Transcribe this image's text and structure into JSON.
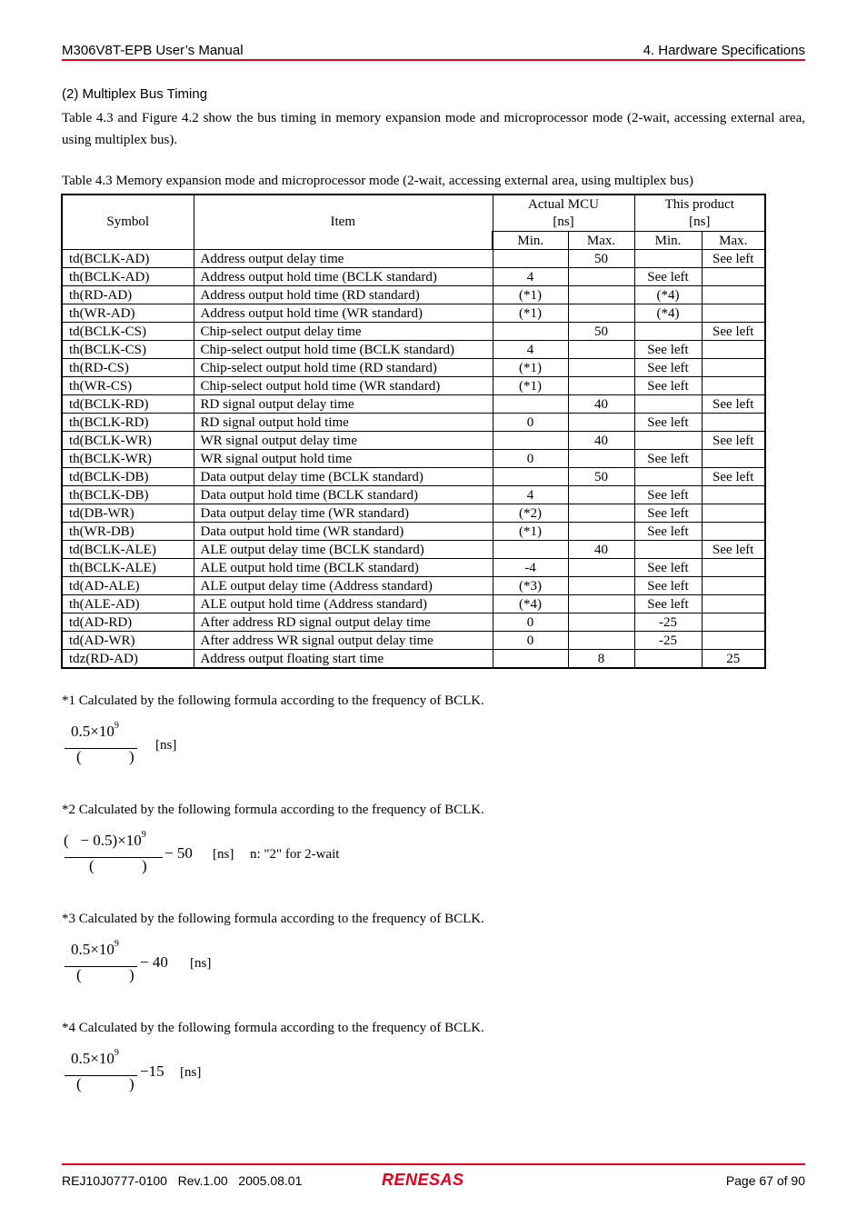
{
  "header": {
    "left": "M306V8T-EPB User’s Manual",
    "right": "4. Hardware Specifications"
  },
  "section": {
    "title": "(2) Multiplex Bus Timing",
    "intro": "Table 4.3 and Figure 4.2 show the bus timing in memory expansion mode and microprocessor mode (2-wait, accessing external area, using multiplex bus)."
  },
  "table": {
    "caption": "Table 4.3 Memory expansion mode and microprocessor mode (2-wait, accessing external area, using multiplex bus)",
    "headers": {
      "symbol": "Symbol",
      "item": "Item",
      "actual_mcu": "Actual MCU",
      "actual_mcu_unit": "[ns]",
      "this_product": "This product",
      "this_product_unit": "[ns]",
      "min": "Min.",
      "max": "Max."
    },
    "rows": [
      {
        "symbol": "td(BCLK-AD)",
        "item": "Address output delay time",
        "mcu_min": "",
        "mcu_max": "50",
        "prod_min": "",
        "prod_max": "See left"
      },
      {
        "symbol": "th(BCLK-AD)",
        "item": "Address output hold time (BCLK standard)",
        "mcu_min": "4",
        "mcu_max": "",
        "prod_min": "See left",
        "prod_max": ""
      },
      {
        "symbol": "th(RD-AD)",
        "item": "Address output hold time (RD standard)",
        "mcu_min": "(*1)",
        "mcu_max": "",
        "prod_min": "(*4)",
        "prod_max": ""
      },
      {
        "symbol": "th(WR-AD)",
        "item": "Address output hold time (WR standard)",
        "mcu_min": "(*1)",
        "mcu_max": "",
        "prod_min": "(*4)",
        "prod_max": ""
      },
      {
        "symbol": "td(BCLK-CS)",
        "item": "Chip-select output delay time",
        "mcu_min": "",
        "mcu_max": "50",
        "prod_min": "",
        "prod_max": "See left"
      },
      {
        "symbol": "th(BCLK-CS)",
        "item": "Chip-select output hold time (BCLK standard)",
        "mcu_min": "4",
        "mcu_max": "",
        "prod_min": "See left",
        "prod_max": ""
      },
      {
        "symbol": "th(RD-CS)",
        "item": "Chip-select output hold time (RD standard)",
        "mcu_min": "(*1)",
        "mcu_max": "",
        "prod_min": "See left",
        "prod_max": ""
      },
      {
        "symbol": "th(WR-CS)",
        "item": "Chip-select output hold time (WR standard)",
        "mcu_min": "(*1)",
        "mcu_max": "",
        "prod_min": "See left",
        "prod_max": ""
      },
      {
        "symbol": "td(BCLK-RD)",
        "item": "RD signal output delay time",
        "mcu_min": "",
        "mcu_max": "40",
        "prod_min": "",
        "prod_max": "See left"
      },
      {
        "symbol": "th(BCLK-RD)",
        "item": "RD signal output hold time",
        "mcu_min": "0",
        "mcu_max": "",
        "prod_min": "See left",
        "prod_max": ""
      },
      {
        "symbol": "td(BCLK-WR)",
        "item": "WR signal output delay time",
        "mcu_min": "",
        "mcu_max": "40",
        "prod_min": "",
        "prod_max": "See left"
      },
      {
        "symbol": "th(BCLK-WR)",
        "item": "WR signal output hold time",
        "mcu_min": "0",
        "mcu_max": "",
        "prod_min": "See left",
        "prod_max": ""
      },
      {
        "symbol": "td(BCLK-DB)",
        "item": "Data output delay time (BCLK standard)",
        "mcu_min": "",
        "mcu_max": "50",
        "prod_min": "",
        "prod_max": "See left"
      },
      {
        "symbol": "th(BCLK-DB)",
        "item": "Data output hold time (BCLK standard)",
        "mcu_min": "4",
        "mcu_max": "",
        "prod_min": "See left",
        "prod_max": ""
      },
      {
        "symbol": "td(DB-WR)",
        "item": "Data output delay time (WR standard)",
        "mcu_min": "(*2)",
        "mcu_max": "",
        "prod_min": "See left",
        "prod_max": ""
      },
      {
        "symbol": "th(WR-DB)",
        "item": "Data output hold time (WR standard)",
        "mcu_min": "(*1)",
        "mcu_max": "",
        "prod_min": "See left",
        "prod_max": ""
      },
      {
        "symbol": "td(BCLK-ALE)",
        "item": "ALE output delay time (BCLK standard)",
        "mcu_min": "",
        "mcu_max": "40",
        "prod_min": "",
        "prod_max": "See left"
      },
      {
        "symbol": "th(BCLK-ALE)",
        "item": "ALE output hold time (BCLK standard)",
        "mcu_min": "-4",
        "mcu_max": "",
        "prod_min": "See left",
        "prod_max": ""
      },
      {
        "symbol": "td(AD-ALE)",
        "item": "ALE output delay time (Address standard)",
        "mcu_min": "(*3)",
        "mcu_max": "",
        "prod_min": "See left",
        "prod_max": ""
      },
      {
        "symbol": "th(ALE-AD)",
        "item": "ALE output hold time (Address standard)",
        "mcu_min": "(*4)",
        "mcu_max": "",
        "prod_min": "See left",
        "prod_max": ""
      },
      {
        "symbol": "td(AD-RD)",
        "item": "After address RD signal output delay time",
        "mcu_min": "0",
        "mcu_max": "",
        "prod_min": "-25",
        "prod_max": ""
      },
      {
        "symbol": "td(AD-WR)",
        "item": "After address WR signal output delay time",
        "mcu_min": "0",
        "mcu_max": "",
        "prod_min": "-25",
        "prod_max": ""
      },
      {
        "symbol": "tdz(RD-AD)",
        "item": "Address output floating start time",
        "mcu_min": "",
        "mcu_max": "8",
        "prod_min": "",
        "prod_max": "25"
      }
    ]
  },
  "notes": [
    {
      "text": "*1 Calculated by the following formula according to the frequency of BCLK.",
      "numerator": "0.5×10",
      "exponent": "9",
      "lparen": "(",
      "rparen": ")",
      "tail": "",
      "unit": "[ns]",
      "extra": ""
    },
    {
      "text": "*2 Calculated by the following formula according to the frequency of BCLK.",
      "numerator": "(   − 0.5)×10",
      "exponent": "9",
      "lparen": "(",
      "rparen": ")",
      "tail": "− 50",
      "unit": "[ns]",
      "extra": "n: \"2\" for 2-wait"
    },
    {
      "text": "*3 Calculated by the following formula according to the frequency of BCLK.",
      "numerator": "0.5×10",
      "exponent": "9",
      "lparen": "(",
      "rparen": ")",
      "tail": "− 40",
      "unit": "[ns]",
      "extra": ""
    },
    {
      "text": "*4 Calculated by the following formula according to the frequency of BCLK.",
      "numerator": "0.5×10",
      "exponent": "9",
      "lparen": "(",
      "rparen": ")",
      "tail": "−15",
      "unit": "[ns]",
      "extra": ""
    }
  ],
  "footer": {
    "doc_id": "REJ10J0777-0100   Rev.1.00   2005.08.01",
    "logo": "RENESAS",
    "page": "Page 67 of 90"
  },
  "colors": {
    "rule": "#e8001c",
    "logo": "#e8001c"
  }
}
